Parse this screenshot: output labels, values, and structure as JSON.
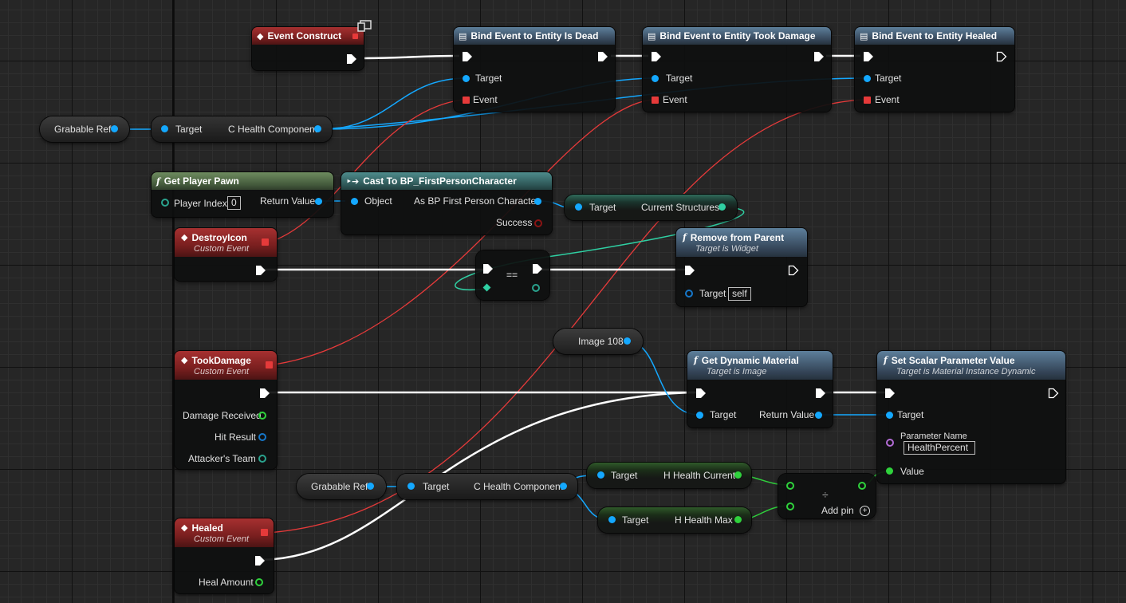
{
  "colors": {
    "exec": "#ffffff",
    "object": "#14a8ff",
    "event": "#e63a3a",
    "float": "#2fd23c",
    "array": "#2fd0a3",
    "name": "#b36cd6"
  },
  "nodes": {
    "event_construct": {
      "title": "Event Construct",
      "monitor_icon": "monitor-icon"
    },
    "bind_dead": {
      "title": "Bind Event to Entity Is Dead",
      "target": "Target",
      "event": "Event"
    },
    "bind_damage": {
      "title": "Bind Event to Entity Took Damage",
      "target": "Target",
      "event": "Event"
    },
    "bind_healed": {
      "title": "Bind Event to Entity Healed",
      "target": "Target",
      "event": "Event"
    },
    "grabable_ref_1": {
      "label": "Grabable Ref"
    },
    "health_comp_1": {
      "target": "Target",
      "output": "C Health Component"
    },
    "get_player_pawn": {
      "title": "Get Player Pawn",
      "player_index": "Player Index",
      "index_value": "0",
      "return_value": "Return Value"
    },
    "cast": {
      "title": "Cast To BP_FirstPersonCharacter",
      "object": "Object",
      "as": "As BP First Person Character",
      "success": "Success"
    },
    "current_structures": {
      "target": "Target",
      "output": "Current Structures"
    },
    "destroy_icon": {
      "title": "DestroyIcon",
      "subtitle": "Custom Event"
    },
    "equal": {
      "symbol": "=="
    },
    "remove_from_parent": {
      "title": "Remove from Parent",
      "subtitle": "Target is Widget",
      "target": "Target",
      "target_value": "self"
    },
    "image_108": {
      "label": "Image 108"
    },
    "took_damage": {
      "title": "TookDamage",
      "subtitle": "Custom Event",
      "damage_received": "Damage Received",
      "hit_result": "Hit Result",
      "attackers_team": "Attacker's Team"
    },
    "get_dynamic_material": {
      "title": "Get Dynamic Material",
      "subtitle": "Target is Image",
      "target": "Target",
      "return_value": "Return Value"
    },
    "set_scalar": {
      "title": "Set Scalar Parameter Value",
      "subtitle": "Target is Material Instance Dynamic",
      "target": "Target",
      "param_name": "Parameter Name",
      "param_value": "HealthPercent",
      "value": "Value"
    },
    "grabable_ref_2": {
      "label": "Grabable Ref"
    },
    "health_comp_2": {
      "target": "Target",
      "output": "C Health Component"
    },
    "health_current": {
      "target": "Target",
      "output": "H Health Current"
    },
    "health_max": {
      "target": "Target",
      "output": "H Health Max"
    },
    "divide": {
      "symbol": "÷",
      "add_pin": "Add pin"
    },
    "healed": {
      "title": "Healed",
      "subtitle": "Custom Event",
      "heal_amount": "Heal Amount"
    }
  }
}
